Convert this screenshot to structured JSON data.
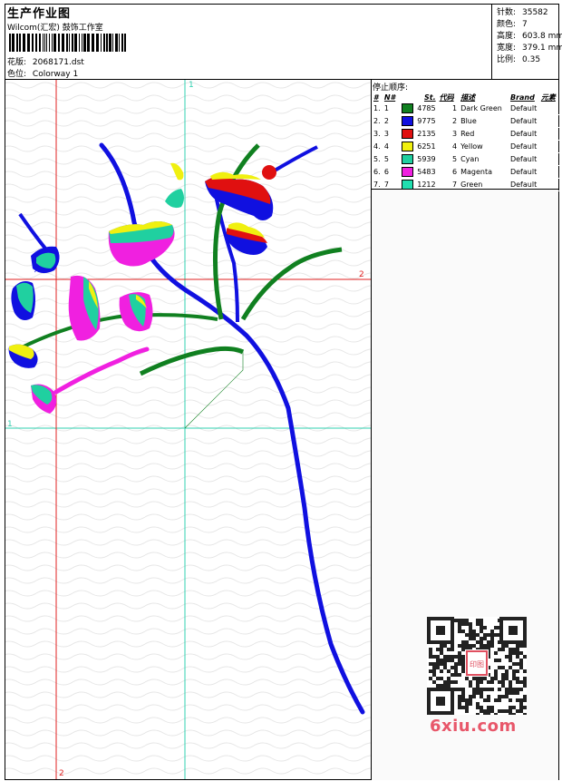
{
  "header": {
    "title": "生产作业图",
    "subtitle": "Wilcom(汇宏) 鼓饰工作室",
    "design_label": "花版:",
    "design_value": "2068171.dst",
    "color_label": "色位:",
    "color_value": "Colorway 1"
  },
  "stats": {
    "stitches_label": "针数:",
    "stitches": "35582",
    "colors_label": "颜色:",
    "colors": "7",
    "height_label": "高度:",
    "height": "603.8 mm",
    "width_label": "宽度:",
    "width": "379.1 mm",
    "scale_label": "比例:",
    "scale": "0.35"
  },
  "stop_sequence": {
    "title": "停止顺序:",
    "headers": [
      "#",
      "N#",
      "St.",
      "代码",
      "描述",
      "Brand",
      "元素"
    ],
    "rows": [
      {
        "num": "1.",
        "n": "1",
        "color": "#108020",
        "st": "4785",
        "code": "1",
        "desc": "Dark Green",
        "brand": "Default"
      },
      {
        "num": "2.",
        "n": "2",
        "color": "#1010e0",
        "st": "9775",
        "code": "2",
        "desc": "Blue",
        "brand": "Default"
      },
      {
        "num": "3.",
        "n": "3",
        "color": "#e01010",
        "st": "2135",
        "code": "3",
        "desc": "Red",
        "brand": "Default"
      },
      {
        "num": "4.",
        "n": "4",
        "color": "#f0f010",
        "st": "6251",
        "code": "4",
        "desc": "Yellow",
        "brand": "Default"
      },
      {
        "num": "5.",
        "n": "5",
        "color": "#20d0a0",
        "st": "5939",
        "code": "5",
        "desc": "Cyan",
        "brand": "Default"
      },
      {
        "num": "6.",
        "n": "6",
        "color": "#f020e0",
        "st": "5483",
        "code": "6",
        "desc": "Magenta",
        "brand": "Default"
      },
      {
        "num": "7.",
        "n": "7",
        "color": "#20e0b0",
        "st": "1212",
        "code": "7",
        "desc": "Green",
        "brand": "Default"
      }
    ]
  },
  "axes": {
    "v1": "1",
    "h2": "2",
    "h1": "1",
    "v2": "2"
  },
  "watermark": {
    "text": "6xiu.com",
    "seal": "印图"
  }
}
